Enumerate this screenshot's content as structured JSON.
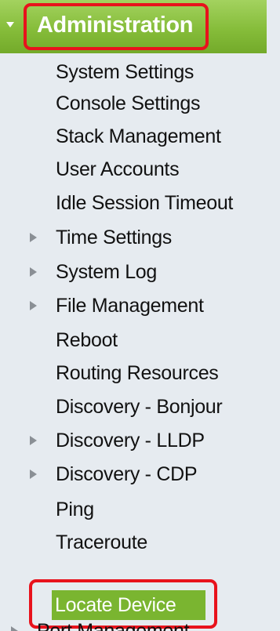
{
  "admin": {
    "label": "Administration"
  },
  "nav": {
    "items": [
      {
        "label": "System Settings",
        "expandable": false
      },
      {
        "label": "Console Settings",
        "expandable": false
      },
      {
        "label": "Stack Management",
        "expandable": false
      },
      {
        "label": "User Accounts",
        "expandable": false
      },
      {
        "label": "Idle Session Timeout",
        "expandable": false
      },
      {
        "label": "Time Settings",
        "expandable": true
      },
      {
        "label": "System Log",
        "expandable": true
      },
      {
        "label": "File Management",
        "expandable": true
      },
      {
        "label": "Reboot",
        "expandable": false
      },
      {
        "label": "Routing Resources",
        "expandable": false
      },
      {
        "label": "Discovery - Bonjour",
        "expandable": false
      },
      {
        "label": "Discovery - LLDP",
        "expandable": true
      },
      {
        "label": "Discovery - CDP",
        "expandable": true
      },
      {
        "label": "Ping",
        "expandable": false
      },
      {
        "label": "Traceroute",
        "expandable": false
      },
      {
        "label": "Locate Device",
        "expandable": false,
        "selected": true
      }
    ],
    "next_section": {
      "label": "Port Management",
      "expandable": true
    }
  },
  "colors": {
    "header_green": "#86bd3a",
    "selected_green": "#7ab530",
    "panel_background": "#e6ebf0",
    "highlight_red": "#e8121c",
    "arrow_gray": "#8a8f95"
  },
  "icons": {
    "expanded": "triangle-down-icon",
    "collapsed": "triangle-right-icon"
  }
}
